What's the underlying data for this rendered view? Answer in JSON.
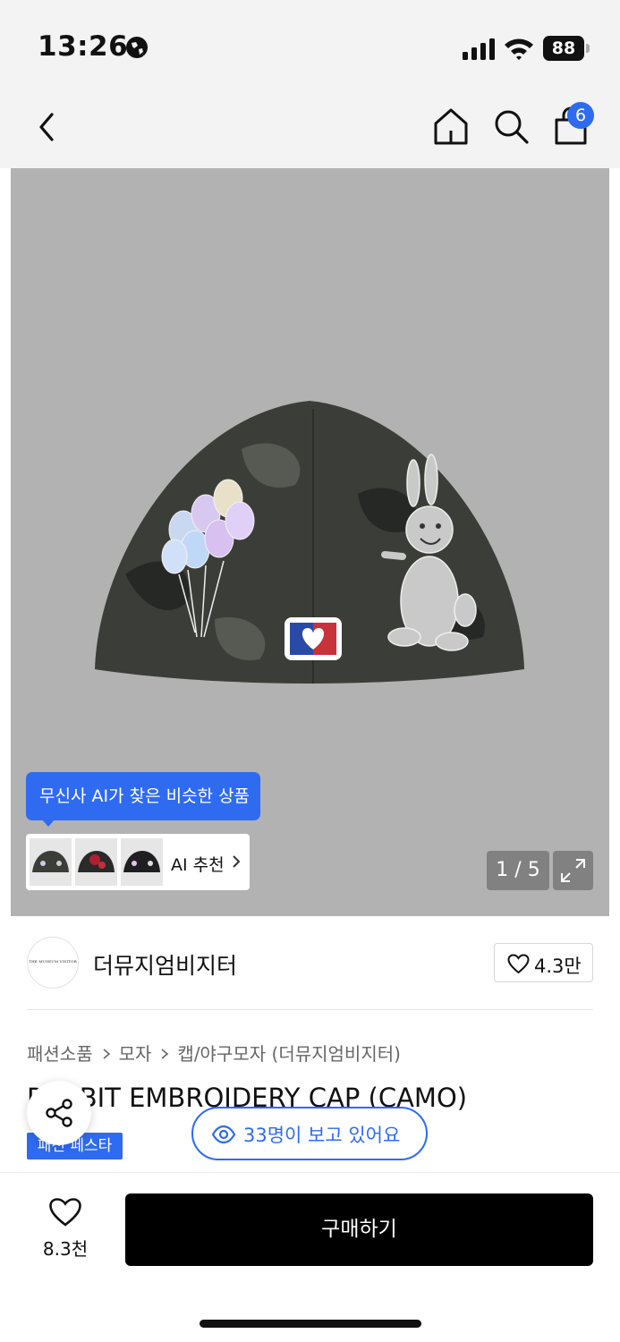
{
  "status_bar": {
    "time": "13:26",
    "battery": "88"
  },
  "nav": {
    "cart_count": "6"
  },
  "product_image": {
    "ai_tooltip": "무신사 AI가 찾은 비슷한 상품",
    "ai_card_label": "AI 추천",
    "page_counter": "1 / 5"
  },
  "brand": {
    "logo_text": "THE MUSEUM VISITOR",
    "name": "더뮤지엄비지터",
    "likes": "4.3만"
  },
  "breadcrumb": [
    "패션소품",
    "모자",
    "캡/야구모자 (더뮤지엄비지터)"
  ],
  "product": {
    "title": "RABBIT EMBROIDERY CAP (CAMO)",
    "badge": "패션 페스타"
  },
  "viewers": "33명이 보고 있어요",
  "bottom": {
    "wish_count": "8.3천",
    "buy_label": "구매하기"
  },
  "colors": {
    "accent": "#2f6bf0",
    "buy_button": "#000000"
  }
}
